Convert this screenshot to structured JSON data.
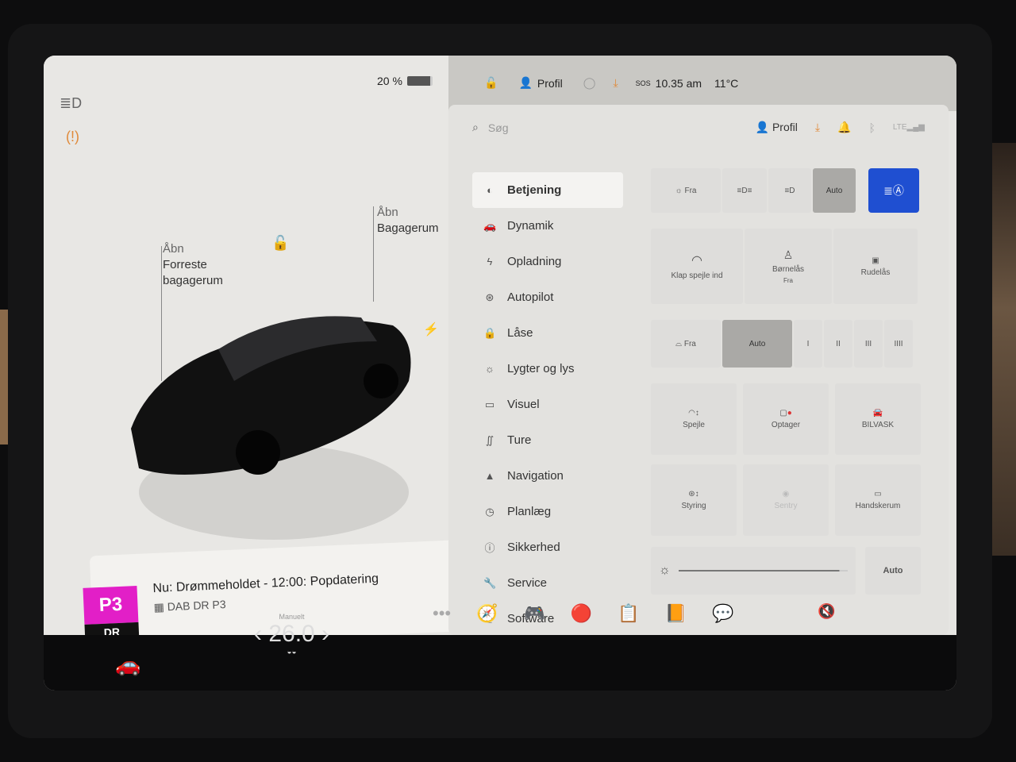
{
  "status": {
    "battery": "20 %",
    "profile": "Profil",
    "time": "10.35 am",
    "temp": "11°C",
    "sos": "SOS"
  },
  "left": {
    "front_trunk": [
      "Åbn",
      "Forreste",
      "bagagerum"
    ],
    "trunk": [
      "Åbn",
      "Bagagerum"
    ]
  },
  "search": {
    "placeholder": "Søg"
  },
  "topbar": {
    "profile": "Profil"
  },
  "menu": [
    {
      "label": "Betjening",
      "icon": "toggle-icon"
    },
    {
      "label": "Dynamik",
      "icon": "car-icon"
    },
    {
      "label": "Opladning",
      "icon": "bolt-icon"
    },
    {
      "label": "Autopilot",
      "icon": "steering-icon"
    },
    {
      "label": "Låse",
      "icon": "lock-icon"
    },
    {
      "label": "Lygter og lys",
      "icon": "sun-icon"
    },
    {
      "label": "Visuel",
      "icon": "display-icon"
    },
    {
      "label": "Ture",
      "icon": "trips-icon"
    },
    {
      "label": "Navigation",
      "icon": "navigation-icon"
    },
    {
      "label": "Planlæg",
      "icon": "clock-icon"
    },
    {
      "label": "Sikkerhed",
      "icon": "info-icon"
    },
    {
      "label": "Service",
      "icon": "wrench-icon"
    },
    {
      "label": "Software",
      "icon": "download-icon"
    }
  ],
  "lights": {
    "off": "Fra",
    "auto": "Auto"
  },
  "controls": {
    "fold_mirrors": "Klap spejle ind",
    "child_lock": "Børnelås",
    "child_lock_state": "Fra",
    "window_lock": "Rudelås"
  },
  "wipers": {
    "off": "Fra",
    "auto": "Auto",
    "speeds": [
      "I",
      "II",
      "III",
      "IIII"
    ]
  },
  "tiles": {
    "mirrors": "Spejle",
    "recorder": "Optager",
    "carwash": "BILVASK",
    "steering": "Styring",
    "sentry": "Sentry",
    "glovebox": "Handskerum"
  },
  "brightness": {
    "auto": "Auto",
    "level": 0.95
  },
  "media": {
    "title": "Nu: Drømmeholdet - 12:00: Popdatering",
    "source": "DAB DR P3",
    "logo_top": "P3",
    "logo_bottom": "DR"
  },
  "climate": {
    "mode": "Manuelt",
    "temp": "26.0"
  },
  "colors": {
    "accent": "#1f4fd1",
    "p3": "#e21fc7"
  }
}
